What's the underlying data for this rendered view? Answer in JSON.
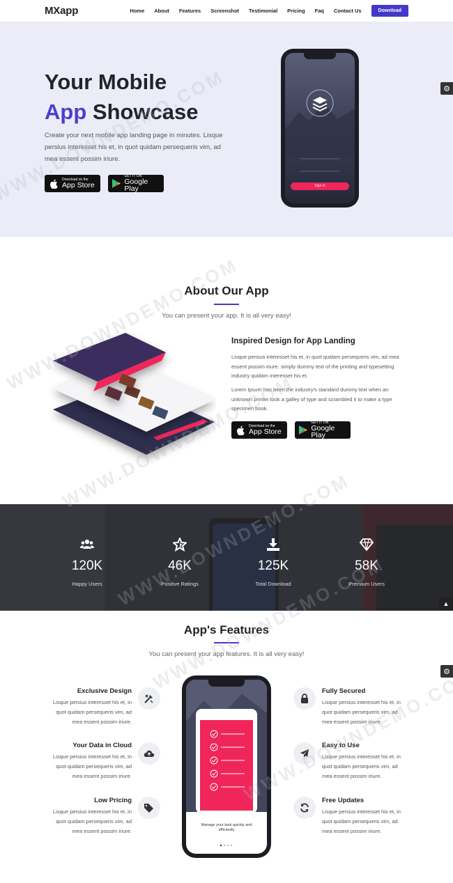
{
  "header": {
    "logo": "MXapp",
    "nav": [
      "Home",
      "About",
      "Features",
      "Screenshot",
      "Testimonial",
      "Pricing",
      "Faq",
      "Contact Us"
    ],
    "download_label": "Download"
  },
  "hero": {
    "title_line1": "Your Mobile",
    "title_accent": "App",
    "title_rest": "Showcase",
    "subtitle": "Create your next mobile app landing page in minutes. Lisque persius interesset his et, in quot quidam persequeris vim, ad mea essent possim iriure.",
    "phone_button": "Sign in"
  },
  "stores": {
    "appstore_small": "Download on the",
    "appstore_big": "App Store",
    "play_small": "GET IT ON",
    "play_big": "Google Play"
  },
  "about": {
    "title": "About Our App",
    "subtitle": "You can present your app. It is all very easy!",
    "heading": "Inspired Design for App Landing",
    "para1": "Lisque persius interesset his et, in quot quidam persequeris vim, ad mea essent possim iriure. simply dummy text of the printing and typesetting industry quidam interesset his et.",
    "para2": "Lorem Ipsum has been the industry's standard dummy text when an unknown printer took a galley of type and scrambled it to make a type specimen book."
  },
  "stats": [
    {
      "icon": "users-icon",
      "value": "120K",
      "label": "Happy Users"
    },
    {
      "icon": "star-icon",
      "value": "46K",
      "label": "Positive Ratings"
    },
    {
      "icon": "download-icon",
      "value": "125K",
      "label": "Total Download"
    },
    {
      "icon": "diamond-icon",
      "value": "58K",
      "label": "Premium Users"
    }
  ],
  "features": {
    "title": "App's Features",
    "subtitle": "You can present your app features. It is all very easy!",
    "left": [
      {
        "icon": "design-tools-icon",
        "title": "Exclusive Design",
        "text": "Lisque persius interesset his et, in quot quidam persequeris vim, ad mea essent possim iriure."
      },
      {
        "icon": "cloud-upload-icon",
        "title": "Your Data in Cloud",
        "text": "Lisque persius interesset his et, in quot quidam persequeris vim, ad mea essent possim iriure."
      },
      {
        "icon": "tags-icon",
        "title": "Low Pricing",
        "text": "Lisque persius interesset his et, in quot quidam persequeris vim, ad mea essent possim iriure."
      }
    ],
    "right": [
      {
        "icon": "lock-icon",
        "title": "Fully Secured",
        "text": "Lisque persius interesset his et, in quot quidam persequeris vim, ad mea essent possim iriure."
      },
      {
        "icon": "paper-plane-icon",
        "title": "Easy to Use",
        "text": "Lisque persius interesset his et, in quot quidam persequeris vim, ad mea essent possim iriure."
      },
      {
        "icon": "refresh-icon",
        "title": "Free Updates",
        "text": "Lisque persius interesset his et, in quot quidam persequeris vim, ad mea essent possim iriure."
      }
    ],
    "phone_caption": "Manage your task quickly and efficiently"
  },
  "colors": {
    "accent": "#4338c9",
    "hero_bg": "#ececf8",
    "pink": "#f0265a"
  }
}
